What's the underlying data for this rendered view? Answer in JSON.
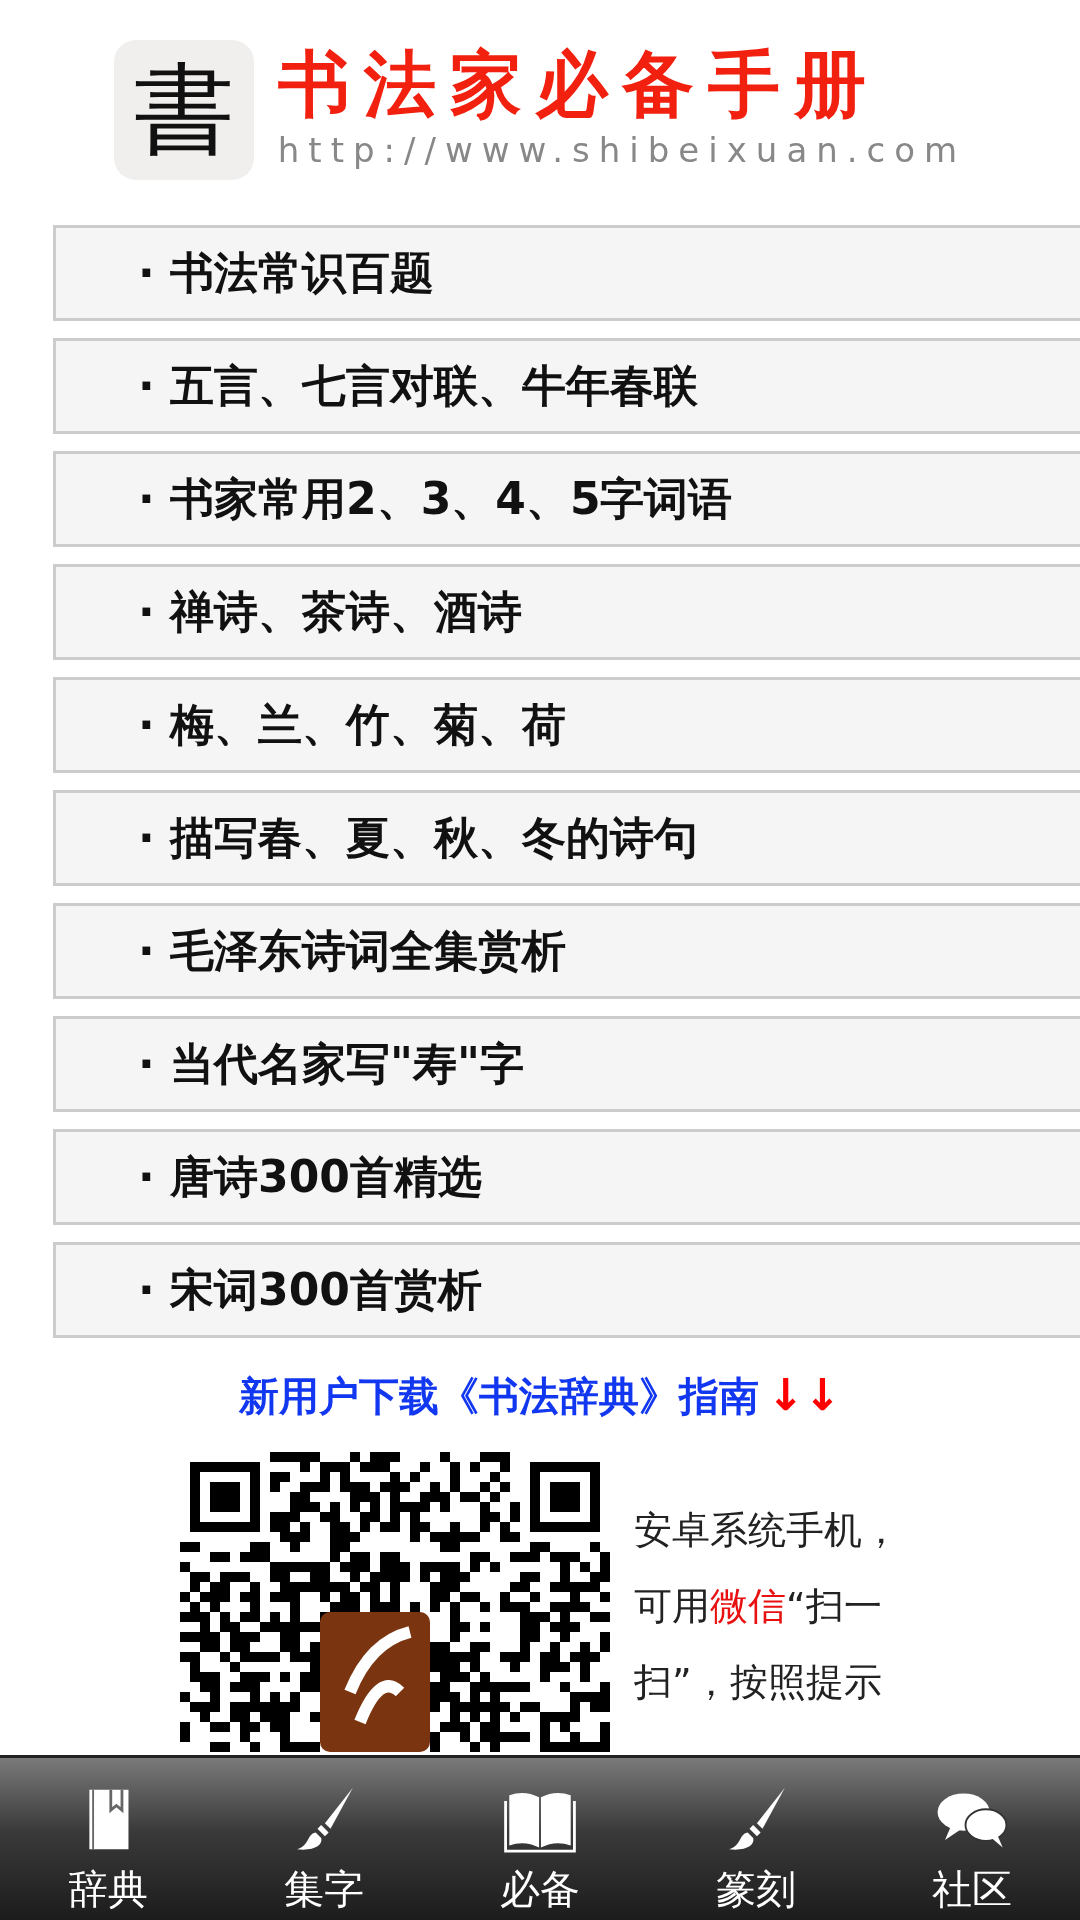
{
  "header": {
    "logo_char": "書",
    "title": "书法家必备手册",
    "url": "http://www.shibeixuan.com"
  },
  "menu": [
    {
      "label": "· 书法常识百题"
    },
    {
      "label": "· 五言、七言对联、牛年春联"
    },
    {
      "label": "· 书家常用2、3、4、5字词语"
    },
    {
      "label": "· 禅诗、茶诗、酒诗"
    },
    {
      "label": "· 梅、兰、竹、菊、荷"
    },
    {
      "label": "· 描写春、夏、秋、冬的诗句"
    },
    {
      "label": "· 毛泽东诗词全集赏析"
    },
    {
      "label": "· 当代名家写\"寿\"字"
    },
    {
      "label": "· 唐诗300首精选"
    },
    {
      "label": "· 宋词300首赏析"
    }
  ],
  "guide": {
    "title": "新用户下载《书法辞典》指南",
    "arrows": "↓↓"
  },
  "qr_note": [
    [
      {
        "text": "安卓系统手机，",
        "kind": "plain"
      }
    ],
    [
      {
        "text": "可用",
        "kind": "plain"
      },
      {
        "text": "微信",
        "kind": "highlight"
      },
      {
        "text": "“扫一",
        "kind": "plain"
      }
    ],
    [
      {
        "text": "扫”，按照提示",
        "kind": "plain"
      }
    ]
  ],
  "tabbar": [
    {
      "label": "辞典",
      "kind": "book"
    },
    {
      "label": "集字",
      "kind": "brush"
    },
    {
      "label": "必备",
      "kind": "openbook"
    },
    {
      "label": "篆刻",
      "kind": "brush"
    },
    {
      "label": "社区",
      "kind": "chat"
    }
  ]
}
